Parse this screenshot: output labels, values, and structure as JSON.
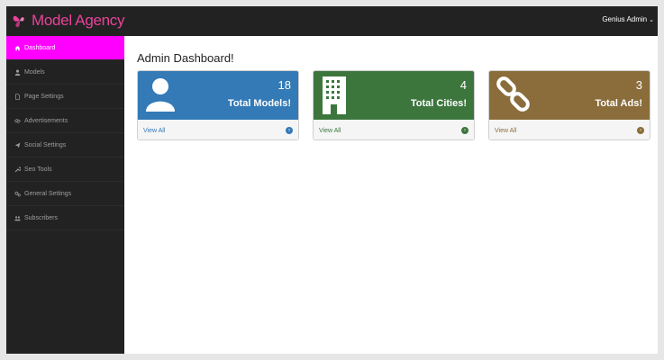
{
  "brand": {
    "name": "Model Agency",
    "color": "#e8439a"
  },
  "user": {
    "name": "Genius Admin",
    "caret": "⌄"
  },
  "sidebar": {
    "active_color": "#ff00ff",
    "items": [
      {
        "label": "Dashboard",
        "icon": "home-icon",
        "active": true
      },
      {
        "label": "Models",
        "icon": "user-icon"
      },
      {
        "label": "Page Settings",
        "icon": "file-icon"
      },
      {
        "label": "Advertisements",
        "icon": "link-icon"
      },
      {
        "label": "Social Settings",
        "icon": "send-icon"
      },
      {
        "label": "Seo Tools",
        "icon": "wrench-icon"
      },
      {
        "label": "General Settings",
        "icon": "gears-icon"
      },
      {
        "label": "Subscribers",
        "icon": "users-icon"
      }
    ]
  },
  "main": {
    "title": "Admin Dashboard!",
    "cards": [
      {
        "count": "18",
        "label": "Total Models!",
        "link": "View All",
        "color": "#337ab7",
        "icon": "user-icon"
      },
      {
        "count": "4",
        "label": "Total Cities!",
        "link": "View All",
        "color": "#3c763d",
        "icon": "building-icon"
      },
      {
        "count": "3",
        "label": "Total Ads!",
        "link": "View All",
        "color": "#8a6d3b",
        "icon": "chain-link-icon"
      }
    ]
  }
}
